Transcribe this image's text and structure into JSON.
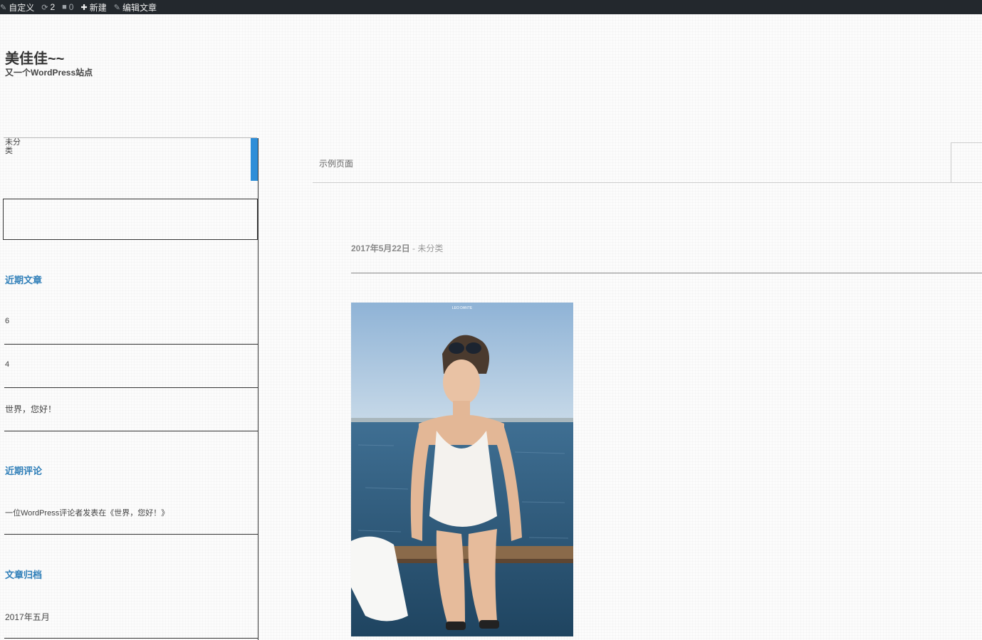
{
  "admin_bar": {
    "customize": "自定义",
    "updates_count": "2",
    "comments_count": "0",
    "new_label": "新建",
    "edit_post": "编辑文章"
  },
  "site": {
    "title": "美佳佳~~",
    "description": "又一个WordPress站点"
  },
  "sidebar": {
    "category_label": "未分类",
    "recent_posts_title": "近期文章",
    "recent_posts": [
      "6",
      "4",
      "世界，您好！"
    ],
    "recent_comments_title": "近期评论",
    "recent_comments": [
      "一位WordPress评论者发表在《世界，您好！》"
    ],
    "archives_title": "文章归档",
    "archives": [
      "2017年五月"
    ]
  },
  "content": {
    "tab_label": "示例页面",
    "post_date": "2017年5月22日",
    "meta_separator": " - ",
    "post_category": "未分类",
    "photo_watermark": "LEO DANTE"
  },
  "colors": {
    "admin_bar": "#23282d",
    "accent": "#2e8ed8",
    "widget_title": "#2e7eb8"
  }
}
